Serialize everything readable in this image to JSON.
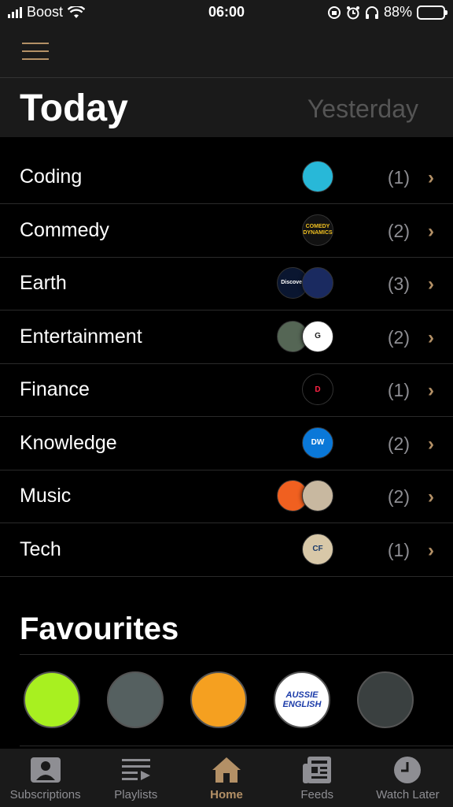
{
  "status": {
    "carrier": "Boost",
    "time": "06:00",
    "battery": "88%",
    "battery_level": 0.88,
    "icons": [
      "signal-icon",
      "wifi-icon",
      "screen-rotation-lock-icon",
      "alarm-icon",
      "headphones-icon",
      "battery-icon"
    ]
  },
  "header": {
    "menu_icon": "hamburger-icon",
    "tab_today": "Today",
    "tab_yesterday": "Yesterday"
  },
  "categories": [
    {
      "label": "Coding",
      "count": "(1)",
      "chevron": "›",
      "avatars": [
        {
          "text": "",
          "bg": "#28b8d8",
          "fg": "#e0304a"
        }
      ]
    },
    {
      "label": "Commedy",
      "count": "(2)",
      "chevron": "›",
      "avatars": [
        {
          "text": "COMEDY DYNAMICS",
          "bg": "#111111",
          "fg": "#f0c020"
        }
      ]
    },
    {
      "label": "Earth",
      "count": "(3)",
      "chevron": "›",
      "avatars": [
        {
          "text": "Discover",
          "bg": "#0a1630",
          "fg": "#ffffff"
        },
        {
          "text": "",
          "bg": "#1a2a60",
          "fg": "#f5c800"
        }
      ]
    },
    {
      "label": "Entertainment",
      "count": "(2)",
      "chevron": "›",
      "avatars": [
        {
          "text": "",
          "bg": "#556655",
          "fg": "#c07040"
        },
        {
          "text": "G",
          "bg": "#ffffff",
          "fg": "#222222"
        }
      ]
    },
    {
      "label": "Finance",
      "count": "(1)",
      "chevron": "›",
      "avatars": [
        {
          "text": "D",
          "bg": "#000000",
          "fg": "#ff2244"
        }
      ]
    },
    {
      "label": "Knowledge",
      "count": "(2)",
      "chevron": "›",
      "avatars": [
        {
          "text": "DW",
          "bg": "#0a78d8",
          "fg": "#ffffff"
        }
      ]
    },
    {
      "label": "Music",
      "count": "(2)",
      "chevron": "›",
      "avatars": [
        {
          "text": "",
          "bg": "#f06020",
          "fg": "#2a6ab8"
        },
        {
          "text": "",
          "bg": "#c8b8a0",
          "fg": "#553322"
        }
      ]
    },
    {
      "label": "Tech",
      "count": "(1)",
      "chevron": "›",
      "avatars": [
        {
          "text": "CF",
          "bg": "#d8c8a8",
          "fg": "#1a3a6a"
        }
      ]
    }
  ],
  "favourites": {
    "title": "Favourites",
    "items": [
      {
        "text": "",
        "bg": "#a8f020",
        "fg": "#333333"
      },
      {
        "text": "",
        "bg": "#556060",
        "fg": "#c06030"
      },
      {
        "text": "",
        "bg": "#f5a020",
        "fg": "#111111"
      },
      {
        "text": "AUSSIE ENGLISH",
        "bg": "#ffffff",
        "fg": "#1a3aa8"
      },
      {
        "text": "",
        "bg": "#3a4040",
        "fg": "#d0c0b0"
      }
    ]
  },
  "tabbar": [
    {
      "label": "Subscriptions",
      "icon": "person-square-icon"
    },
    {
      "label": "Playlists",
      "icon": "playlist-icon"
    },
    {
      "label": "Home",
      "icon": "home-icon",
      "active": true
    },
    {
      "label": "Feeds",
      "icon": "newspaper-icon"
    },
    {
      "label": "Watch Later",
      "icon": "clock-icon"
    }
  ],
  "colors": {
    "accent": "#b39066",
    "muted": "#8e8e93",
    "bg": "#000000",
    "bar": "#1a1a1a"
  }
}
